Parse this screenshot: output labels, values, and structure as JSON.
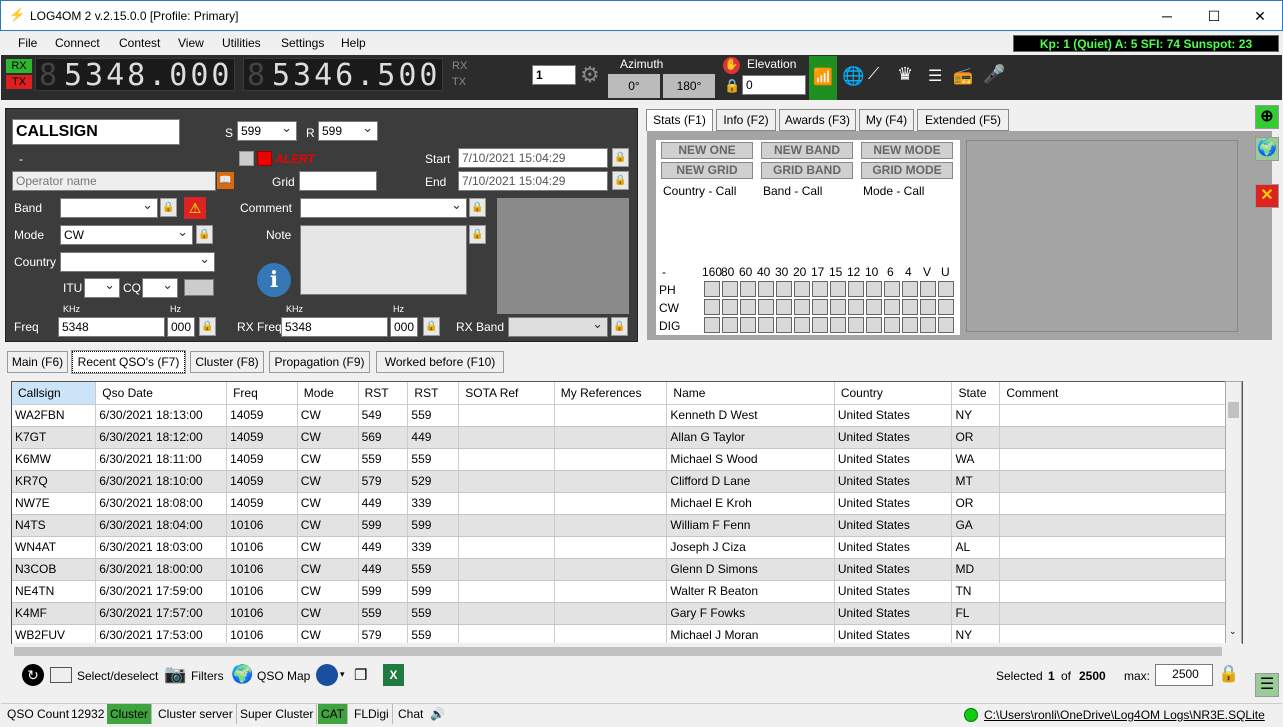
{
  "window": {
    "title": "LOG4OM 2 v.2.15.0.0 [Profile: Primary]",
    "minimize": "─",
    "maximize": "☐",
    "close": "✕"
  },
  "menu": [
    "File",
    "Connect",
    "Contest",
    "View",
    "Utilities",
    "Settings",
    "Help"
  ],
  "solar": "Kp: 1 (Quiet)  A: 5  SFI: 74 Sunspot: 23",
  "radio": {
    "rx": "RX",
    "tx": "TX",
    "freq_main": "5348.000",
    "freq_rx": "5346.500",
    "rx_label2": "RX",
    "tx_label2": "TX",
    "vfo_value": "1",
    "azimuth_label": "Azimuth",
    "azimuth_short": "0°",
    "azimuth_long": "180°",
    "elevation_label": "Elevation",
    "elevation_value": "0"
  },
  "qso": {
    "callsign": "CALLSIGN",
    "s_label": "S",
    "s_value": "599",
    "r_label": "R",
    "r_value": "599",
    "dash": "-",
    "alert": "ALERT",
    "operator_placeholder": "Operator name",
    "grid_label": "Grid",
    "start_label": "Start",
    "start_value": "7/10/2021 15:04:29",
    "end_label": "End",
    "end_value": "7/10/2021 15:04:29",
    "band_label": "Band",
    "band_value": "",
    "mode_label": "Mode",
    "mode_value": "CW",
    "country_label": "Country",
    "country_value": "",
    "comment_label": "Comment",
    "note_label": "Note",
    "itu_label": "ITU",
    "cq_label": "CQ",
    "khz_label": "KHz",
    "hz_label": "Hz",
    "freq_label": "Freq",
    "freq_khz": "5348",
    "freq_hz": "000",
    "rxfreq_label": "RX Freq",
    "rxfreq_khz": "5348",
    "rxfreq_hz": "000",
    "rxband_label": "RX Band"
  },
  "stats_tabs": [
    "Stats (F1)",
    "Info (F2)",
    "Awards (F3)",
    "My (F4)",
    "Extended (F5)"
  ],
  "stats": {
    "new_buttons": [
      [
        "NEW ONE",
        "NEW GRID"
      ],
      [
        "NEW BAND",
        "GRID BAND"
      ],
      [
        "NEW MODE",
        "GRID MODE"
      ]
    ],
    "captions": [
      "Country - Call",
      "Band - Call",
      "Mode - Call"
    ],
    "band_header_dash": "-",
    "bands": [
      "160",
      "80",
      "60",
      "40",
      "30",
      "20",
      "17",
      "15",
      "12",
      "10",
      "6",
      "4",
      "V",
      "U"
    ],
    "modes": [
      "PH",
      "CW",
      "DIG"
    ]
  },
  "bottom_tabs": [
    "Main (F6)",
    "Recent QSO's (F7)",
    "Cluster (F8)",
    "Propagation (F9)",
    "Worked before (F10)"
  ],
  "table": {
    "columns": [
      "Callsign",
      "Qso Date",
      "Freq",
      "Mode",
      "RST",
      "RST",
      "SOTA Ref",
      "My References",
      "Name",
      "Country",
      "State",
      "Comment"
    ],
    "rows": [
      [
        "WA2FBN",
        "6/30/2021 18:13:00",
        "14059",
        "CW",
        "549",
        "559",
        "",
        "",
        "Kenneth D West",
        "United States",
        "NY",
        ""
      ],
      [
        "K7GT",
        "6/30/2021 18:12:00",
        "14059",
        "CW",
        "569",
        "449",
        "",
        "",
        "Allan G Taylor",
        "United States",
        "OR",
        ""
      ],
      [
        "K6MW",
        "6/30/2021 18:11:00",
        "14059",
        "CW",
        "559",
        "559",
        "",
        "",
        "Michael S Wood",
        "United States",
        "WA",
        ""
      ],
      [
        "KR7Q",
        "6/30/2021 18:10:00",
        "14059",
        "CW",
        "579",
        "529",
        "",
        "",
        "Clifford D Lane",
        "United States",
        "MT",
        ""
      ],
      [
        "NW7E",
        "6/30/2021 18:08:00",
        "14059",
        "CW",
        "449",
        "339",
        "",
        "",
        "Michael E Kroh",
        "United States",
        "OR",
        ""
      ],
      [
        "N4TS",
        "6/30/2021 18:04:00",
        "10106",
        "CW",
        "599",
        "599",
        "",
        "",
        "William F Fenn",
        "United States",
        "GA",
        ""
      ],
      [
        "WN4AT",
        "6/30/2021 18:03:00",
        "10106",
        "CW",
        "449",
        "339",
        "",
        "",
        "Joseph J Ciza",
        "United States",
        "AL",
        ""
      ],
      [
        "N3COB",
        "6/30/2021 18:00:00",
        "10106",
        "CW",
        "449",
        "559",
        "",
        "",
        "Glenn D Simons",
        "United States",
        "MD",
        ""
      ],
      [
        "NE4TN",
        "6/30/2021 17:59:00",
        "10106",
        "CW",
        "599",
        "599",
        "",
        "",
        "Walter R Beaton",
        "United States",
        "TN",
        ""
      ],
      [
        "K4MF",
        "6/30/2021 17:57:00",
        "10106",
        "CW",
        "559",
        "559",
        "",
        "",
        "Gary F Fowks",
        "United States",
        "FL",
        ""
      ],
      [
        "WB2FUV",
        "6/30/2021 17:53:00",
        "10106",
        "CW",
        "579",
        "559",
        "",
        "",
        "Michael J Moran",
        "United States",
        "NY",
        ""
      ]
    ]
  },
  "toolbar": {
    "select": "Select/deselect",
    "filters": "Filters",
    "qsomap": "QSO Map",
    "selected_label": "Selected",
    "selected_value": "1",
    "of_label": "of",
    "total": "2500",
    "max_label": "max:",
    "max_value": "2500"
  },
  "statusbar": {
    "qso_count_label": "QSO Count",
    "qso_count": "12932",
    "items": [
      "Cluster",
      "Cluster server",
      "Super Cluster",
      "CAT",
      "FLDigi",
      "Chat"
    ],
    "db_path": "C:\\Users\\ronli\\OneDrive\\Log4OM Logs\\NR3E.SQLite"
  }
}
